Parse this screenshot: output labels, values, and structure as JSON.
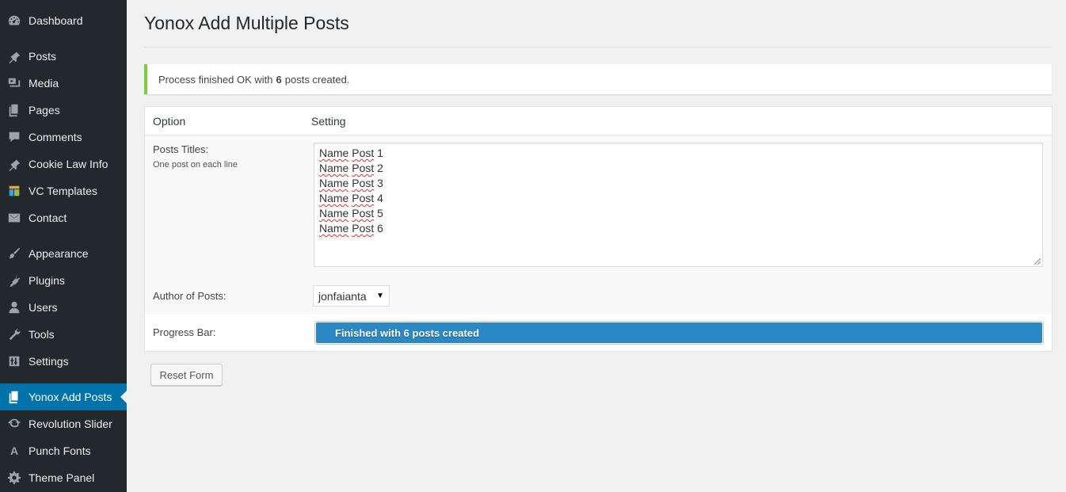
{
  "sidebar": {
    "items": [
      {
        "label": "Dashboard",
        "icon": "dashboard-icon"
      },
      {
        "label": "Posts",
        "icon": "pin-icon"
      },
      {
        "label": "Media",
        "icon": "media-icon"
      },
      {
        "label": "Pages",
        "icon": "pages-icon"
      },
      {
        "label": "Comments",
        "icon": "comment-icon"
      },
      {
        "label": "Cookie Law Info",
        "icon": "pin-icon"
      },
      {
        "label": "VC Templates",
        "icon": "grid-icon"
      },
      {
        "label": "Contact",
        "icon": "envelope-icon"
      },
      {
        "label": "Appearance",
        "icon": "brush-icon"
      },
      {
        "label": "Plugins",
        "icon": "plug-icon"
      },
      {
        "label": "Users",
        "icon": "user-icon"
      },
      {
        "label": "Tools",
        "icon": "wrench-icon"
      },
      {
        "label": "Settings",
        "icon": "sliders-icon"
      },
      {
        "label": "Yonox Add Posts",
        "icon": "pages-icon",
        "active": true
      },
      {
        "label": "Revolution Slider",
        "icon": "refresh-icon"
      },
      {
        "label": "Punch Fonts",
        "icon": "font-icon"
      },
      {
        "label": "Theme Panel",
        "icon": "gear-icon"
      }
    ]
  },
  "page": {
    "title": "Yonox Add Multiple Posts"
  },
  "notice": {
    "prefix": "Process finished OK with",
    "count": "6",
    "suffix": "posts created."
  },
  "table": {
    "col_option": "Option",
    "col_setting": "Setting",
    "titles_label": "Posts Titles:",
    "titles_hint": "One post on each line",
    "titles_lines": [
      {
        "a": "Name",
        "b": "Post",
        "n": "1"
      },
      {
        "a": "Name",
        "b": "Post",
        "n": "2"
      },
      {
        "a": "Name",
        "b": "Post",
        "n": "3"
      },
      {
        "a": "Name",
        "b": "Post",
        "n": "4"
      },
      {
        "a": "Name",
        "b": "Post",
        "n": "5"
      },
      {
        "a": "Name",
        "b": "Post",
        "n": "6"
      }
    ],
    "author_label": "Author of Posts:",
    "author_value": "jonfaianta",
    "progress_label": "Progress Bar:",
    "progress_text": "Finished with 6 posts created",
    "progress_fraction": 1.0
  },
  "buttons": {
    "reset": "Reset Form"
  },
  "colors": {
    "sidebar_bg": "#23282d",
    "active_bg": "#0073aa",
    "notice_border": "#7ad03a",
    "progress_fill": "#2a88c6"
  }
}
